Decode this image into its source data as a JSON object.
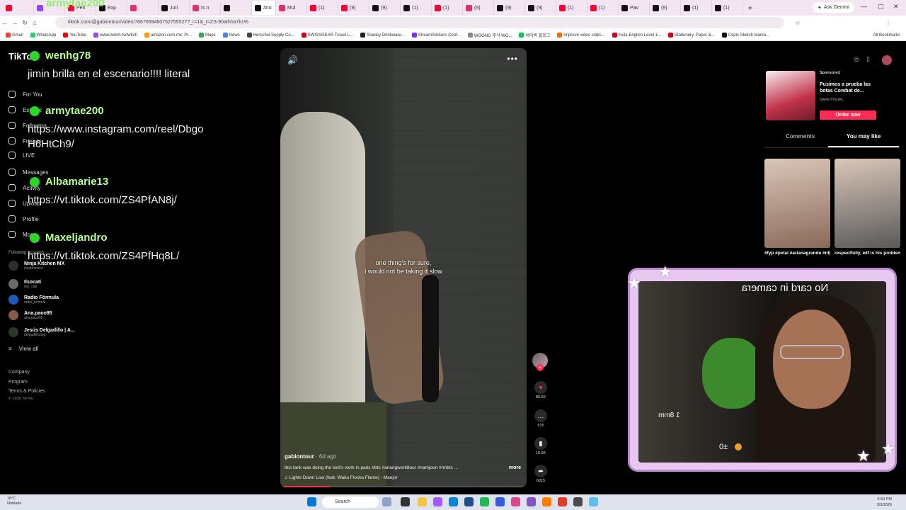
{
  "browser": {
    "tabs": [
      {
        "label": "",
        "color": "#ff0033"
      },
      {
        "label": "",
        "color": "#9146ff"
      },
      {
        "label": "Pen",
        "color": "#ff0033"
      },
      {
        "label": "Exp",
        "color": "#111111"
      },
      {
        "label": "",
        "color": "#e1306c"
      },
      {
        "label": "Juri",
        "color": "#111111"
      },
      {
        "label": "Is n",
        "color": "#e1306c"
      },
      {
        "label": "",
        "color": "#111111"
      },
      {
        "label": "#no",
        "color": "#111111"
      },
      {
        "label": "Mul",
        "color": "#e1306c"
      },
      {
        "label": "(1)",
        "color": "#ff0033"
      },
      {
        "label": "(9)",
        "color": "#ff0033"
      },
      {
        "label": "(9)",
        "color": "#111111"
      },
      {
        "label": "(1)",
        "color": "#111111"
      },
      {
        "label": "(1)",
        "color": "#ff0033"
      },
      {
        "label": "(9)",
        "color": "#e1306c"
      },
      {
        "label": "(9)",
        "color": "#111111"
      },
      {
        "label": "(9)",
        "color": "#111111"
      },
      {
        "label": "(1)",
        "color": "#ff0033"
      },
      {
        "label": "(1)",
        "color": "#ff0033"
      },
      {
        "label": "Pav",
        "color": "#111111"
      },
      {
        "label": "(9)",
        "color": "#111111"
      },
      {
        "label": "(1)",
        "color": "#111111"
      },
      {
        "label": "(1)",
        "color": "#111111"
      }
    ],
    "ask_gemini": "Ask Gemini",
    "url": "tiktok.com/@gabiontour/video/7667669480752755527?_r=1&_t=ZS-90athha7k1%",
    "bookmarks": [
      {
        "label": "Gmail",
        "color": "#ea4335"
      },
      {
        "label": "WhatsApp",
        "color": "#25d366"
      },
      {
        "label": "YouTube",
        "color": "#ff0000"
      },
      {
        "label": "www.twitch.tv/twitch",
        "color": "#9146ff"
      },
      {
        "label": "amazon.com.mx: Pr...",
        "color": "#ff9900"
      },
      {
        "label": "Maps",
        "color": "#34a853"
      },
      {
        "label": "News",
        "color": "#4285f4"
      },
      {
        "label": "Herschel Supply Co...",
        "color": "#444444"
      },
      {
        "label": "SWISSGEAR Travel L...",
        "color": "#d0021b"
      },
      {
        "label": "Stanley Drinkware...",
        "color": "#222222"
      },
      {
        "label": "StreamStickers Conf...",
        "color": "#7b2ff7"
      },
      {
        "label": "WOONG 주식 WO...",
        "color": "#888888"
      },
      {
        "label": "네이버 블로그",
        "color": "#03c75a"
      },
      {
        "label": "Improve video statis...",
        "color": "#ff6a00"
      },
      {
        "label": "Insta English Level 1...",
        "color": "#d0021b"
      },
      {
        "label": "Stationery, Paper &...",
        "color": "#d0021b"
      },
      {
        "label": "Copic Sketch Marke...",
        "color": "#111111"
      }
    ],
    "all_bookmarks": "All Bookmarks"
  },
  "sidebar": {
    "logo": "TikTok",
    "nav": [
      "For You",
      "Explore",
      "Following",
      "Friends",
      "LIVE",
      "Messages",
      "Activity",
      "Upload",
      "Profile",
      "More"
    ],
    "following_title": "Following accounts",
    "accounts": [
      {
        "name": "Ninja Kitchen MX",
        "handle": "ninjamexico",
        "color": "#2e2e2e"
      },
      {
        "name": "Ilsocati",
        "handle": "ilse_cati",
        "color": "#6b6b6b"
      },
      {
        "name": "Radio Fórmula",
        "handle": "radio_formula",
        "color": "#1e5bb8"
      },
      {
        "name": "Ana.paoo95",
        "handle": "ana.paoo95",
        "color": "#8b5a4a"
      },
      {
        "name": "Jesús Delgadillo | A...",
        "handle": "delgadillosnjg",
        "color": "#2a3a2a"
      }
    ],
    "view_all": "View all",
    "footer": [
      "Company",
      "Program",
      "Terms & Policies",
      "© 2026 TikTok"
    ]
  },
  "chat": {
    "top_partial": "armytae200",
    "messages": [
      {
        "user": "wenhg78",
        "text": "jimin brilla en el escenario!!!! literal"
      },
      {
        "user": "armytae200",
        "text": "https://www.instagram.com/reel/Dbgo H6HtCh9/"
      },
      {
        "user": "Albamarie13",
        "text": "https://vt.tiktok.com/ZS4PfAN8j/"
      },
      {
        "user": "Maxeljandro",
        "text": "https://vt.tiktok.com/ZS4PfHq8L/"
      }
    ]
  },
  "video": {
    "caption_line1": "one thing's for sure,",
    "caption_line2": "i would not be taking it slow",
    "author": "gabiontour",
    "ago": "· 6d ago",
    "description": "this tank was doing the lord's work in paris #bts #ariangworldtour #namjoon #rmbts ...",
    "more": "more",
    "music": "♫  Lights Down Low (feat. Waka Flocka Flame) - Maejor",
    "progress": 0.2,
    "likes": "80.6K",
    "comments": "915",
    "saves": "10.9K",
    "shares": "6015"
  },
  "right_panel": {
    "sponsored": "Sponsored",
    "ad_title": "Pusimos a prueba las botas Combat de...",
    "ad_brand": "SAFETYGIRL",
    "ad_button": "Order now",
    "tab_comments": "Comments",
    "tab_you_may_like": "You may like",
    "thumbs": [
      {
        "caption": "#fyp #petal #arianagrande #nfpe...",
        "color": "#8a6a5a"
      },
      {
        "caption": "respectfully, wtf is his problem #bts...",
        "color": "#5a5a5a"
      }
    ]
  },
  "webcam": {
    "title": "No card in camera",
    "sub": "1 8mm",
    "foot": "0±"
  },
  "taskbar": {
    "weather_temp": "18°C",
    "weather_desc": "Nublado",
    "search": "Search",
    "time": "9:53 PM",
    "date": "3/3/2026"
  }
}
